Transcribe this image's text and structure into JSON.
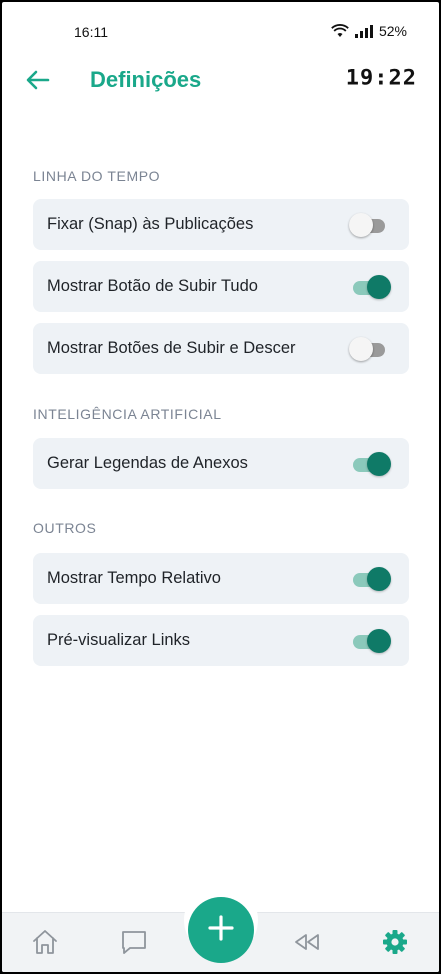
{
  "status_bar": {
    "time": "16:11",
    "battery": "52%",
    "icons": [
      "wifi-icon",
      "signal-icon"
    ]
  },
  "header": {
    "title": "Definições",
    "clock": "19:22",
    "back_icon": "arrow-left-icon"
  },
  "sections": [
    {
      "label": "LINHA DO TEMPO",
      "items": [
        {
          "label": "Fixar (Snap) às Publicações",
          "enabled": false
        },
        {
          "label": "Mostrar Botão de Subir Tudo",
          "enabled": true
        },
        {
          "label": "Mostrar Botões de Subir e Descer",
          "enabled": false
        }
      ]
    },
    {
      "label": "INTELIGÊNCIA ARTIFICIAL",
      "items": [
        {
          "label": "Gerar Legendas de Anexos",
          "enabled": true
        }
      ]
    },
    {
      "label": "OUTROS",
      "items": [
        {
          "label": "Mostrar Tempo Relativo",
          "enabled": true
        },
        {
          "label": "Pré-visualizar Links",
          "enabled": true
        }
      ]
    }
  ],
  "bottom_nav": {
    "items": [
      "home-icon",
      "chat-icon",
      "add-icon",
      "rewind-icon",
      "settings-icon"
    ],
    "active": "settings-icon"
  },
  "colors": {
    "accent": "#1aa88a",
    "toggle_on_thumb": "#0f7a67",
    "toggle_on_track": "#8bc9bb",
    "row_bg": "#eef2f6",
    "section_label": "#7b8493"
  }
}
